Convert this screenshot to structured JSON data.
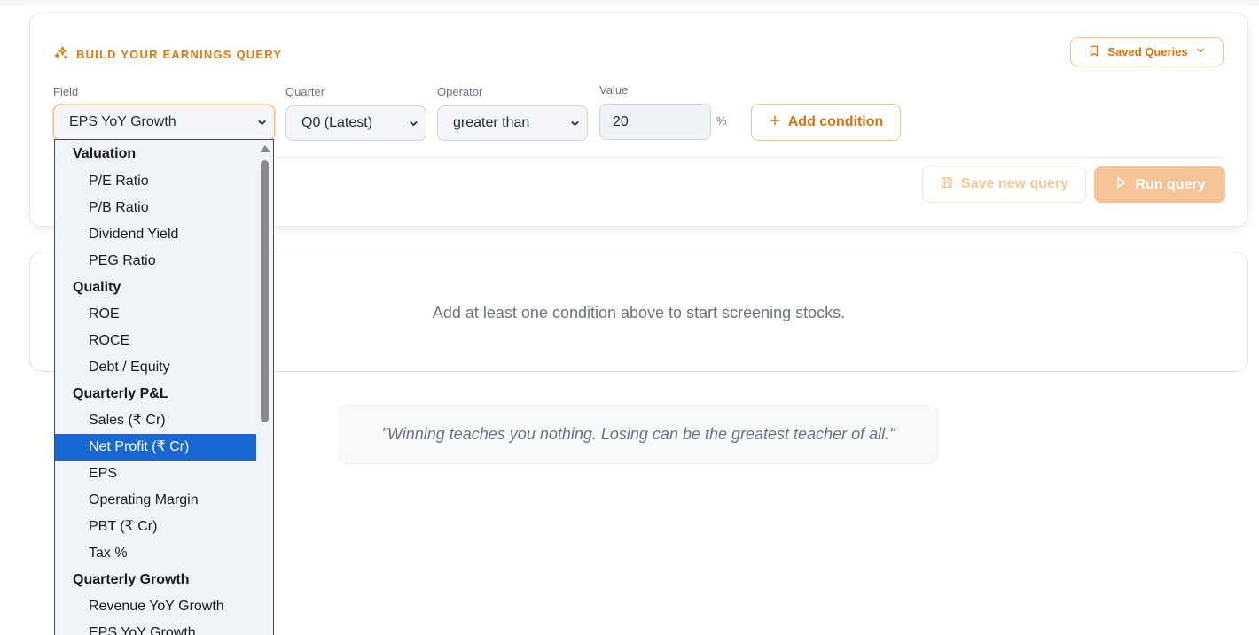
{
  "builder": {
    "title": "BUILD YOUR EARNINGS QUERY",
    "saved_queries_label": "Saved Queries",
    "field_label": "Field",
    "quarter_label": "Quarter",
    "operator_label": "Operator",
    "value_label": "Value",
    "field_value": "EPS YoY Growth",
    "quarter_value": "Q0 (Latest)",
    "operator_value": "greater than",
    "value": "20",
    "unit": "%",
    "add_condition_label": "Add condition",
    "save_new_query_label": "Save new query",
    "run_query_label": "Run query"
  },
  "empty_state": {
    "message": "Add at least one condition above to start screening stocks."
  },
  "quote": "\"Winning teaches you nothing. Losing can be the greatest teacher of all.\"",
  "field_dropdown": {
    "groups": [
      {
        "label": "Valuation",
        "options": [
          "P/E Ratio",
          "P/B Ratio",
          "Dividend Yield",
          "PEG Ratio"
        ]
      },
      {
        "label": "Quality",
        "options": [
          "ROE",
          "ROCE",
          "Debt / Equity"
        ]
      },
      {
        "label": "Quarterly P&L",
        "options": [
          "Sales (₹ Cr)",
          "Net Profit (₹ Cr)",
          "EPS",
          "Operating Margin",
          "PBT (₹ Cr)",
          "Tax %"
        ]
      },
      {
        "label": "Quarterly Growth",
        "options": [
          "Revenue YoY Growth",
          "EPS YoY Growth"
        ]
      }
    ],
    "highlighted": "Net Profit (₹ Cr)"
  },
  "colors": {
    "accent": "#e07b10",
    "highlight": "#1967d2"
  }
}
